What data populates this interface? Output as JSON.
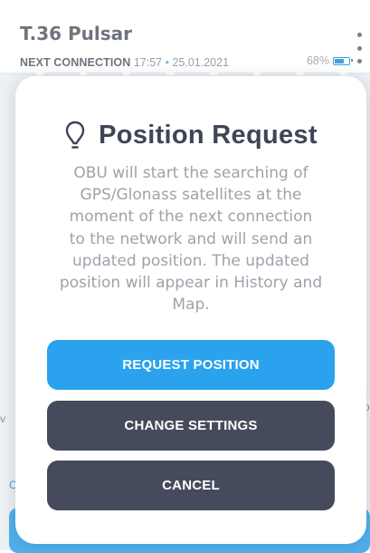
{
  "header": {
    "title": "T.36 Pulsar",
    "next_connection_label": "NEXT CONNECTION",
    "time": "17:57",
    "separator": "•",
    "date": "25.01.2021",
    "battery": "68%",
    "battery_level": 0.68
  },
  "background": {
    "left_fragment": "v",
    "right_fragment_1": "t",
    "right_fragment_2": "o",
    "left_fragment_2": "C"
  },
  "dialog": {
    "title": "Position Request",
    "icon": "location-pin-icon",
    "body_lines": [
      "OBU will start the searching of",
      "GPS/Glonass satellites at the",
      "moment of the next connection",
      "to the network and will send an",
      "updated position. The updated",
      "position will appear in History and",
      "Map."
    ],
    "buttons": {
      "request": "REQUEST POSITION",
      "settings": "CHANGE SETTINGS",
      "cancel": "CANCEL"
    }
  },
  "colors": {
    "primary": "#2aa2ed",
    "dark_button": "#454b5c",
    "title_text": "#3f4557",
    "body_text": "#9da3ab",
    "accent_blue": "#3ea0e2"
  }
}
